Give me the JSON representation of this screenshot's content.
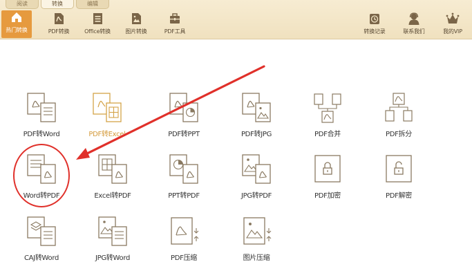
{
  "tabs": [
    {
      "label": "阅读",
      "active": false
    },
    {
      "label": "转换",
      "active": true
    },
    {
      "label": "编辑",
      "active": false
    }
  ],
  "toolbar": {
    "left": [
      {
        "label": "热门转换",
        "icon": "home-icon",
        "active": true
      },
      {
        "label": "PDF转换",
        "icon": "pdf-file-icon",
        "active": false
      },
      {
        "label": "Office转换",
        "icon": "office-doc-icon",
        "active": false
      },
      {
        "label": "图片转换",
        "icon": "image-file-icon",
        "active": false
      },
      {
        "label": "PDF工具",
        "icon": "toolbox-icon",
        "active": false
      }
    ],
    "right": [
      {
        "label": "转换记录",
        "icon": "history-icon"
      },
      {
        "label": "联系我们",
        "icon": "contact-icon"
      },
      {
        "label": "我的VIP",
        "icon": "crown-icon"
      }
    ]
  },
  "features": [
    {
      "label": "PDF转Word",
      "icon": "pdf-to-word-icon"
    },
    {
      "label": "PDF转Excel",
      "icon": "pdf-to-excel-icon",
      "highlight": true
    },
    {
      "label": "PDF转PPT",
      "icon": "pdf-to-ppt-icon"
    },
    {
      "label": "PDF转JPG",
      "icon": "pdf-to-jpg-icon"
    },
    {
      "label": "PDF合并",
      "icon": "pdf-merge-icon"
    },
    {
      "label": "PDF拆分",
      "icon": "pdf-split-icon"
    },
    {
      "label": "Word转PDF",
      "icon": "word-to-pdf-icon"
    },
    {
      "label": "Excel转PDF",
      "icon": "excel-to-pdf-icon"
    },
    {
      "label": "PPT转PDF",
      "icon": "ppt-to-pdf-icon"
    },
    {
      "label": "JPG转PDF",
      "icon": "jpg-to-pdf-icon"
    },
    {
      "label": "PDF加密",
      "icon": "pdf-encrypt-icon"
    },
    {
      "label": "PDF解密",
      "icon": "pdf-decrypt-icon"
    },
    {
      "label": "CAJ转Word",
      "icon": "caj-to-word-icon"
    },
    {
      "label": "JPG转Word",
      "icon": "jpg-to-word-icon"
    },
    {
      "label": "PDF压缩",
      "icon": "pdf-compress-icon"
    },
    {
      "label": "图片压缩",
      "icon": "image-compress-icon"
    }
  ],
  "colors": {
    "toolbar_bg": "#f3e6c8",
    "accent": "#e69a3e",
    "icon_stroke": "#8a7a62",
    "highlight_text": "#d49a3a",
    "annotation_red": "#e0302a"
  }
}
